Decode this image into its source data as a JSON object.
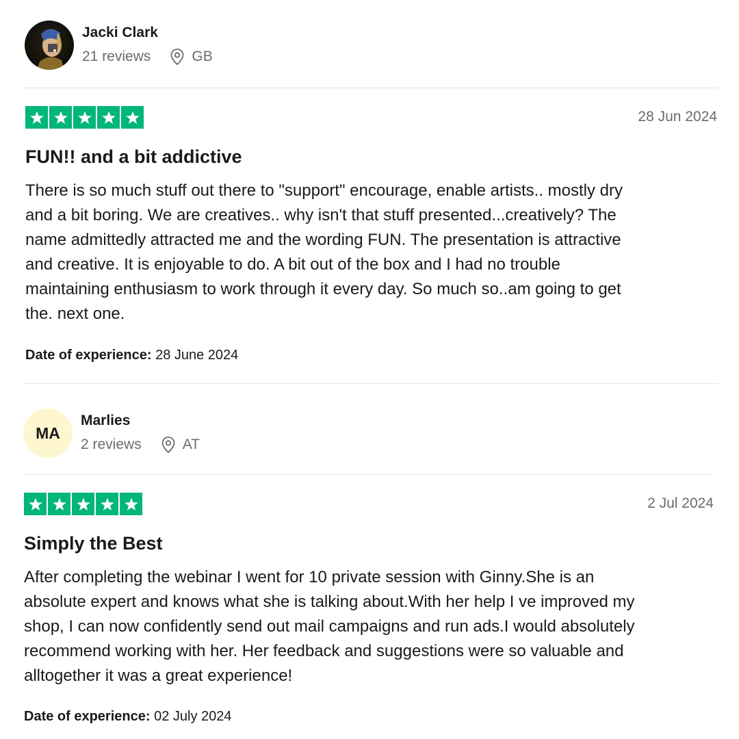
{
  "reviews": [
    {
      "reviewer": {
        "name": "Jacki Clark",
        "reviews_count": "21 reviews",
        "country": "GB",
        "avatar": "photo"
      },
      "rating": 5,
      "date": "28 Jun 2024",
      "title": "FUN!! and a bit addictive",
      "body_lines": [
        "There is so much stuff out there to \"support\" encourage, enable artists.. mostly dry",
        "and a bit boring. We are creatives.. why isn't that stuff presented...creatively? The",
        "name admittedly attracted me and the wording FUN. The presentation is attractive",
        "and creative. It is enjoyable to do. A bit out of the box and I had no trouble",
        "maintaining enthusiasm to work through it every day. So much so..am going to get",
        "the. next one."
      ],
      "experience_label": "Date of experience:",
      "experience_date": "28 June 2024"
    },
    {
      "reviewer": {
        "name": "Marlies",
        "initials": "MA",
        "reviews_count": "2 reviews",
        "country": "AT"
      },
      "rating": 5,
      "date": "2 Jul 2024",
      "title": "Simply the Best",
      "body_lines": [
        "After completing the webinar I went for 10 private session with Ginny.She is an",
        "absolute expert and knows what she is talking about.With her help I ve improved my",
        "shop, I can now confidently send out mail campaigns and run ads.I would absolutely",
        "recommend working with her. Her feedback and suggestions were so valuable and",
        "alltogether it was a great experience!"
      ],
      "experience_label": "Date of experience:",
      "experience_date": "02 July 2024"
    }
  ],
  "colors": {
    "star_green": "#00b67a",
    "initials_avatar_bg": "#fdf6cf",
    "muted_text": "#6b6b6b",
    "divider": "#e3e3e3"
  },
  "icons": {
    "location": "location-pin-icon",
    "star": "star-icon"
  }
}
